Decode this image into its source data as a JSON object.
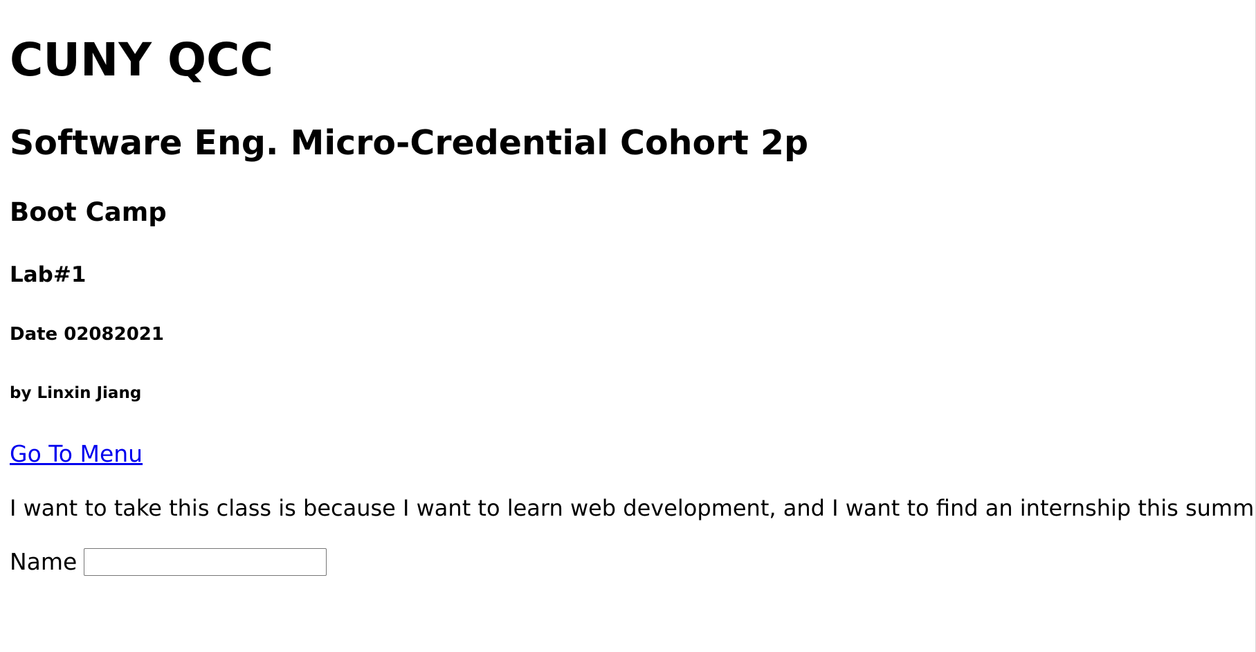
{
  "headings": {
    "h1": "CUNY QCC",
    "h2": "Software Eng. Micro-Credential Cohort 2p",
    "h3": "Boot Camp",
    "h4": "Lab#1",
    "h5": "Date 02082021",
    "h6": "by Linxin Jiang"
  },
  "menu_link": {
    "label": "Go To Menu"
  },
  "statement": "I want to take this class is because I want to learn web development, and I want to find an internship this summer.",
  "form": {
    "name_label": "Name",
    "name_value": "",
    "name_placeholder": ""
  },
  "colors": {
    "link": "#0000ee",
    "text": "#000000",
    "background": "#ffffff"
  }
}
